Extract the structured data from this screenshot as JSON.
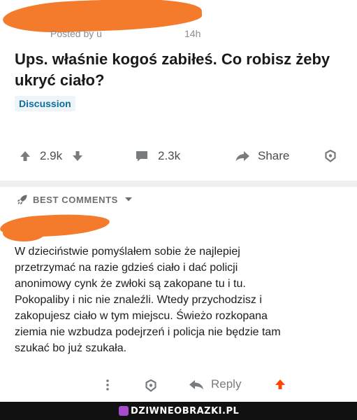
{
  "post": {
    "posted_by": "Posted by u",
    "time": "14h",
    "title": "Ups. właśnie kogoś zabiłeś. Co robisz żeby ukryć ciało?",
    "flair": "Discussion",
    "votes": "2.9k",
    "comments": "2.3k",
    "share_label": "Share"
  },
  "best_comments": {
    "label": "BEST COMMENTS"
  },
  "comment": {
    "lines": [
      "W dzieciństwie pomyślałem sobie że najlepiej",
      "przetrzymać na razie gdzieś ciało i dać policji",
      "anonimowy cynk że zwłoki są zakopane tu i tu.",
      "Pokopaliby i nic nie znaleźli. Wtedy przychodzisz i",
      "zakopujesz ciało w tym miejscu. Świeżo rozkopana",
      "ziemia nie wzbudza podejrzeń i policja nie będzie tam",
      "szukać bo już szukała."
    ],
    "reply_label": "Reply"
  },
  "footer": {
    "watermark": "DZIWNEOBRAZKI.PL"
  },
  "colors": {
    "redaction": "#f47a2c",
    "upvote_accent": "#ff4500",
    "flair_text": "#0a6f9c",
    "footer_bg": "#111111",
    "logo": "#a64bc9"
  }
}
